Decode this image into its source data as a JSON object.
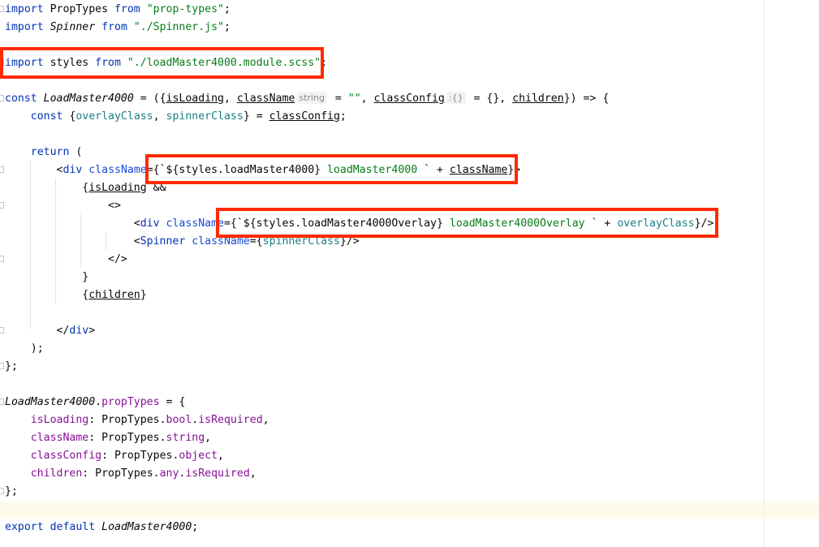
{
  "lines": [
    {
      "segments": [
        {
          "t": "import",
          "c": "kw"
        },
        {
          "t": " PropTypes ",
          "c": ""
        },
        {
          "t": "from",
          "c": "kw"
        },
        {
          "t": " ",
          "c": ""
        },
        {
          "t": "\"prop-types\"",
          "c": "str"
        },
        {
          "t": ";",
          "c": ""
        }
      ]
    },
    {
      "segments": [
        {
          "t": "import",
          "c": "kw"
        },
        {
          "t": " ",
          "c": ""
        },
        {
          "t": "Spinner",
          "c": "it"
        },
        {
          "t": " ",
          "c": ""
        },
        {
          "t": "from",
          "c": "kw"
        },
        {
          "t": " ",
          "c": ""
        },
        {
          "t": "\"./Spinner.js\"",
          "c": "str"
        },
        {
          "t": ";",
          "c": ""
        }
      ]
    },
    {
      "segments": []
    },
    {
      "segments": [
        {
          "t": "import",
          "c": "kw"
        },
        {
          "t": " styles ",
          "c": ""
        },
        {
          "t": "from",
          "c": "kw"
        },
        {
          "t": " ",
          "c": ""
        },
        {
          "t": "\"./loadMaster4000.module.scss\"",
          "c": "str"
        },
        {
          "t": ";",
          "c": ""
        }
      ]
    },
    {
      "segments": []
    },
    {
      "segments": [
        {
          "t": "const",
          "c": "kw"
        },
        {
          "t": " ",
          "c": ""
        },
        {
          "t": "LoadMaster4000",
          "c": "it"
        },
        {
          "t": " = ({",
          "c": ""
        },
        {
          "t": "isLoading",
          "c": "param"
        },
        {
          "t": ", ",
          "c": ""
        },
        {
          "t": "className",
          "c": "param"
        },
        {
          "t": "string",
          "c": "hint"
        },
        {
          "t": " = ",
          "c": ""
        },
        {
          "t": "\"\"",
          "c": "str"
        },
        {
          "t": ", ",
          "c": ""
        },
        {
          "t": "classConfig",
          "c": "param"
        },
        {
          "t": ":{}",
          "c": "hint"
        },
        {
          "t": " = {}, ",
          "c": ""
        },
        {
          "t": "children",
          "c": "param"
        },
        {
          "t": "}) => {",
          "c": ""
        }
      ]
    },
    {
      "segments": [
        {
          "t": "    ",
          "c": ""
        },
        {
          "t": "const",
          "c": "kw"
        },
        {
          "t": " {",
          "c": ""
        },
        {
          "t": "overlayClass",
          "c": "var"
        },
        {
          "t": ", ",
          "c": ""
        },
        {
          "t": "spinnerClass",
          "c": "var"
        },
        {
          "t": "} = ",
          "c": ""
        },
        {
          "t": "classConfig",
          "c": "param"
        },
        {
          "t": ";",
          "c": ""
        }
      ]
    },
    {
      "segments": []
    },
    {
      "segments": [
        {
          "t": "    ",
          "c": ""
        },
        {
          "t": "return",
          "c": "kw"
        },
        {
          "t": " (",
          "c": ""
        }
      ]
    },
    {
      "segments": [
        {
          "t": "        <",
          "c": ""
        },
        {
          "t": "div",
          "c": "tag"
        },
        {
          "t": " ",
          "c": ""
        },
        {
          "t": "className",
          "c": "attr"
        },
        {
          "t": "={`${styles.loadMaster4000} ",
          "c": ""
        },
        {
          "t": "loadMaster4000 ",
          "c": "str"
        },
        {
          "t": "` + ",
          "c": ""
        },
        {
          "t": "className",
          "c": "param"
        },
        {
          "t": "}>",
          "c": ""
        }
      ]
    },
    {
      "segments": [
        {
          "t": "            {",
          "c": ""
        },
        {
          "t": "isLoading",
          "c": "param"
        },
        {
          "t": " &&",
          "c": ""
        }
      ]
    },
    {
      "segments": [
        {
          "t": "                <>",
          "c": ""
        }
      ]
    },
    {
      "segments": [
        {
          "t": "                    <",
          "c": ""
        },
        {
          "t": "div",
          "c": "tag"
        },
        {
          "t": " ",
          "c": ""
        },
        {
          "t": "className",
          "c": "attr"
        },
        {
          "t": "={`${styles.loadMaster4000Overlay} ",
          "c": ""
        },
        {
          "t": "loadMaster4000Overlay ",
          "c": "str"
        },
        {
          "t": "` + ",
          "c": ""
        },
        {
          "t": "overlayClass",
          "c": "var"
        },
        {
          "t": "}/>",
          "c": ""
        }
      ]
    },
    {
      "segments": [
        {
          "t": "                    <",
          "c": ""
        },
        {
          "t": "Spinner",
          "c": "tag"
        },
        {
          "t": " ",
          "c": ""
        },
        {
          "t": "className",
          "c": "attr"
        },
        {
          "t": "={",
          "c": ""
        },
        {
          "t": "spinnerClass",
          "c": "var"
        },
        {
          "t": "}/>",
          "c": ""
        }
      ]
    },
    {
      "segments": [
        {
          "t": "                </>",
          "c": ""
        }
      ]
    },
    {
      "segments": [
        {
          "t": "            }",
          "c": ""
        }
      ]
    },
    {
      "segments": [
        {
          "t": "            {",
          "c": ""
        },
        {
          "t": "children",
          "c": "param"
        },
        {
          "t": "}",
          "c": ""
        }
      ]
    },
    {
      "segments": []
    },
    {
      "segments": [
        {
          "t": "        </",
          "c": ""
        },
        {
          "t": "div",
          "c": "tag"
        },
        {
          "t": ">",
          "c": ""
        }
      ]
    },
    {
      "segments": [
        {
          "t": "    );",
          "c": ""
        }
      ]
    },
    {
      "segments": [
        {
          "t": "};",
          "c": ""
        }
      ]
    },
    {
      "segments": []
    },
    {
      "segments": [
        {
          "t": "LoadMaster4000",
          "c": "it"
        },
        {
          "t": ".",
          "c": ""
        },
        {
          "t": "propTypes",
          "c": "fld"
        },
        {
          "t": " = {",
          "c": ""
        }
      ]
    },
    {
      "segments": [
        {
          "t": "    ",
          "c": ""
        },
        {
          "t": "isLoading",
          "c": "fld"
        },
        {
          "t": ": PropTypes.",
          "c": ""
        },
        {
          "t": "bool",
          "c": "fld"
        },
        {
          "t": ".",
          "c": ""
        },
        {
          "t": "isRequired",
          "c": "fld"
        },
        {
          "t": ",",
          "c": ""
        }
      ]
    },
    {
      "segments": [
        {
          "t": "    ",
          "c": ""
        },
        {
          "t": "className",
          "c": "fld"
        },
        {
          "t": ": PropTypes.",
          "c": ""
        },
        {
          "t": "string",
          "c": "fld"
        },
        {
          "t": ",",
          "c": ""
        }
      ]
    },
    {
      "segments": [
        {
          "t": "    ",
          "c": ""
        },
        {
          "t": "classConfig",
          "c": "fld"
        },
        {
          "t": ": PropTypes.",
          "c": ""
        },
        {
          "t": "object",
          "c": "fld"
        },
        {
          "t": ",",
          "c": ""
        }
      ]
    },
    {
      "segments": [
        {
          "t": "    ",
          "c": ""
        },
        {
          "t": "children",
          "c": "fld"
        },
        {
          "t": ": PropTypes.",
          "c": ""
        },
        {
          "t": "any",
          "c": "fld"
        },
        {
          "t": ".",
          "c": ""
        },
        {
          "t": "isRequired",
          "c": "fld"
        },
        {
          "t": ",",
          "c": ""
        }
      ]
    },
    {
      "segments": [
        {
          "t": "};",
          "c": ""
        }
      ]
    },
    {
      "segments": []
    },
    {
      "segments": [
        {
          "t": "export",
          "c": "kw"
        },
        {
          "t": " ",
          "c": ""
        },
        {
          "t": "default",
          "c": "kw"
        },
        {
          "t": " ",
          "c": ""
        },
        {
          "t": "LoadMaster4000",
          "c": "it"
        },
        {
          "t": ";",
          "c": ""
        }
      ]
    }
  ],
  "highlight_color": "#ff2a00"
}
